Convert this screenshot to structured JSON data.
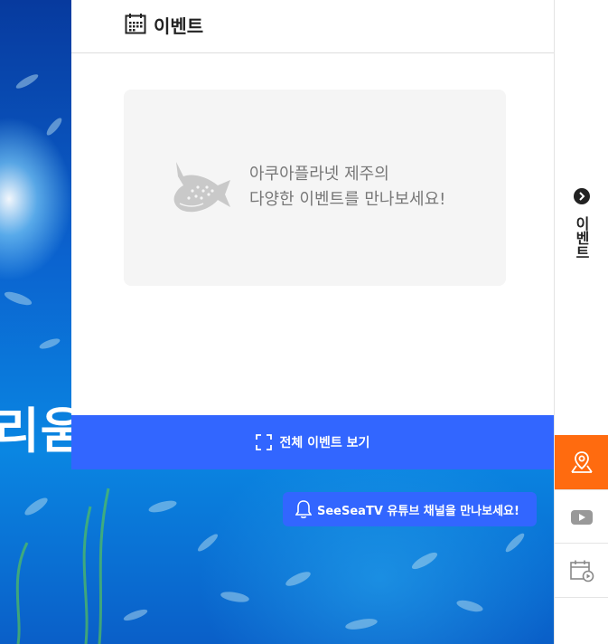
{
  "background": {
    "title_fragment": "리움"
  },
  "panel": {
    "title": "이벤트",
    "empty_message_line1": "아쿠아플라넷 제주의",
    "empty_message_line2": "다양한 이벤트를 만나보세요!",
    "view_all_label": "전체 이벤트 보기"
  },
  "tv_banner": {
    "label": "SeeSeaTV 유튜브 채널을 만나보세요!"
  },
  "rail": {
    "tab_label": "이벤트",
    "buttons": [
      {
        "icon": "map-pin-icon"
      },
      {
        "icon": "youtube-icon"
      },
      {
        "icon": "schedule-icon"
      }
    ]
  },
  "colors": {
    "accent_blue": "#3266ff",
    "accent_orange": "#ff6b0f",
    "ocean": "#0a63cf"
  }
}
